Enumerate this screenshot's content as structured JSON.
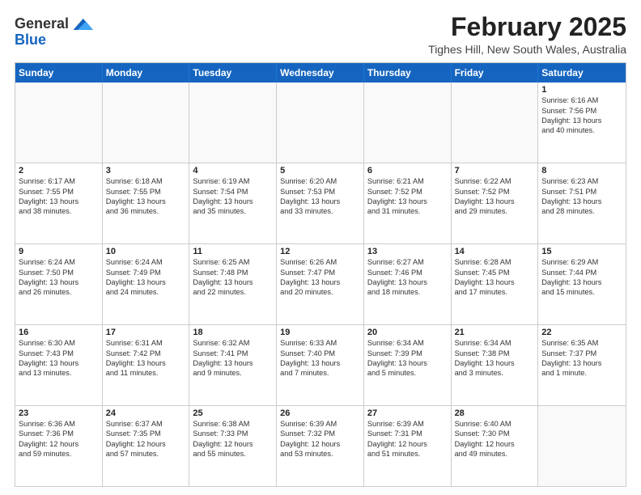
{
  "header": {
    "logo_general": "General",
    "logo_blue": "Blue",
    "month_title": "February 2025",
    "location": "Tighes Hill, New South Wales, Australia"
  },
  "weekdays": [
    "Sunday",
    "Monday",
    "Tuesday",
    "Wednesday",
    "Thursday",
    "Friday",
    "Saturday"
  ],
  "rows": [
    [
      {
        "day": "",
        "text": ""
      },
      {
        "day": "",
        "text": ""
      },
      {
        "day": "",
        "text": ""
      },
      {
        "day": "",
        "text": ""
      },
      {
        "day": "",
        "text": ""
      },
      {
        "day": "",
        "text": ""
      },
      {
        "day": "1",
        "text": "Sunrise: 6:16 AM\nSunset: 7:56 PM\nDaylight: 13 hours\nand 40 minutes."
      }
    ],
    [
      {
        "day": "2",
        "text": "Sunrise: 6:17 AM\nSunset: 7:55 PM\nDaylight: 13 hours\nand 38 minutes."
      },
      {
        "day": "3",
        "text": "Sunrise: 6:18 AM\nSunset: 7:55 PM\nDaylight: 13 hours\nand 36 minutes."
      },
      {
        "day": "4",
        "text": "Sunrise: 6:19 AM\nSunset: 7:54 PM\nDaylight: 13 hours\nand 35 minutes."
      },
      {
        "day": "5",
        "text": "Sunrise: 6:20 AM\nSunset: 7:53 PM\nDaylight: 13 hours\nand 33 minutes."
      },
      {
        "day": "6",
        "text": "Sunrise: 6:21 AM\nSunset: 7:52 PM\nDaylight: 13 hours\nand 31 minutes."
      },
      {
        "day": "7",
        "text": "Sunrise: 6:22 AM\nSunset: 7:52 PM\nDaylight: 13 hours\nand 29 minutes."
      },
      {
        "day": "8",
        "text": "Sunrise: 6:23 AM\nSunset: 7:51 PM\nDaylight: 13 hours\nand 28 minutes."
      }
    ],
    [
      {
        "day": "9",
        "text": "Sunrise: 6:24 AM\nSunset: 7:50 PM\nDaylight: 13 hours\nand 26 minutes."
      },
      {
        "day": "10",
        "text": "Sunrise: 6:24 AM\nSunset: 7:49 PM\nDaylight: 13 hours\nand 24 minutes."
      },
      {
        "day": "11",
        "text": "Sunrise: 6:25 AM\nSunset: 7:48 PM\nDaylight: 13 hours\nand 22 minutes."
      },
      {
        "day": "12",
        "text": "Sunrise: 6:26 AM\nSunset: 7:47 PM\nDaylight: 13 hours\nand 20 minutes."
      },
      {
        "day": "13",
        "text": "Sunrise: 6:27 AM\nSunset: 7:46 PM\nDaylight: 13 hours\nand 18 minutes."
      },
      {
        "day": "14",
        "text": "Sunrise: 6:28 AM\nSunset: 7:45 PM\nDaylight: 13 hours\nand 17 minutes."
      },
      {
        "day": "15",
        "text": "Sunrise: 6:29 AM\nSunset: 7:44 PM\nDaylight: 13 hours\nand 15 minutes."
      }
    ],
    [
      {
        "day": "16",
        "text": "Sunrise: 6:30 AM\nSunset: 7:43 PM\nDaylight: 13 hours\nand 13 minutes."
      },
      {
        "day": "17",
        "text": "Sunrise: 6:31 AM\nSunset: 7:42 PM\nDaylight: 13 hours\nand 11 minutes."
      },
      {
        "day": "18",
        "text": "Sunrise: 6:32 AM\nSunset: 7:41 PM\nDaylight: 13 hours\nand 9 minutes."
      },
      {
        "day": "19",
        "text": "Sunrise: 6:33 AM\nSunset: 7:40 PM\nDaylight: 13 hours\nand 7 minutes."
      },
      {
        "day": "20",
        "text": "Sunrise: 6:34 AM\nSunset: 7:39 PM\nDaylight: 13 hours\nand 5 minutes."
      },
      {
        "day": "21",
        "text": "Sunrise: 6:34 AM\nSunset: 7:38 PM\nDaylight: 13 hours\nand 3 minutes."
      },
      {
        "day": "22",
        "text": "Sunrise: 6:35 AM\nSunset: 7:37 PM\nDaylight: 13 hours\nand 1 minute."
      }
    ],
    [
      {
        "day": "23",
        "text": "Sunrise: 6:36 AM\nSunset: 7:36 PM\nDaylight: 12 hours\nand 59 minutes."
      },
      {
        "day": "24",
        "text": "Sunrise: 6:37 AM\nSunset: 7:35 PM\nDaylight: 12 hours\nand 57 minutes."
      },
      {
        "day": "25",
        "text": "Sunrise: 6:38 AM\nSunset: 7:33 PM\nDaylight: 12 hours\nand 55 minutes."
      },
      {
        "day": "26",
        "text": "Sunrise: 6:39 AM\nSunset: 7:32 PM\nDaylight: 12 hours\nand 53 minutes."
      },
      {
        "day": "27",
        "text": "Sunrise: 6:39 AM\nSunset: 7:31 PM\nDaylight: 12 hours\nand 51 minutes."
      },
      {
        "day": "28",
        "text": "Sunrise: 6:40 AM\nSunset: 7:30 PM\nDaylight: 12 hours\nand 49 minutes."
      },
      {
        "day": "",
        "text": ""
      }
    ]
  ]
}
